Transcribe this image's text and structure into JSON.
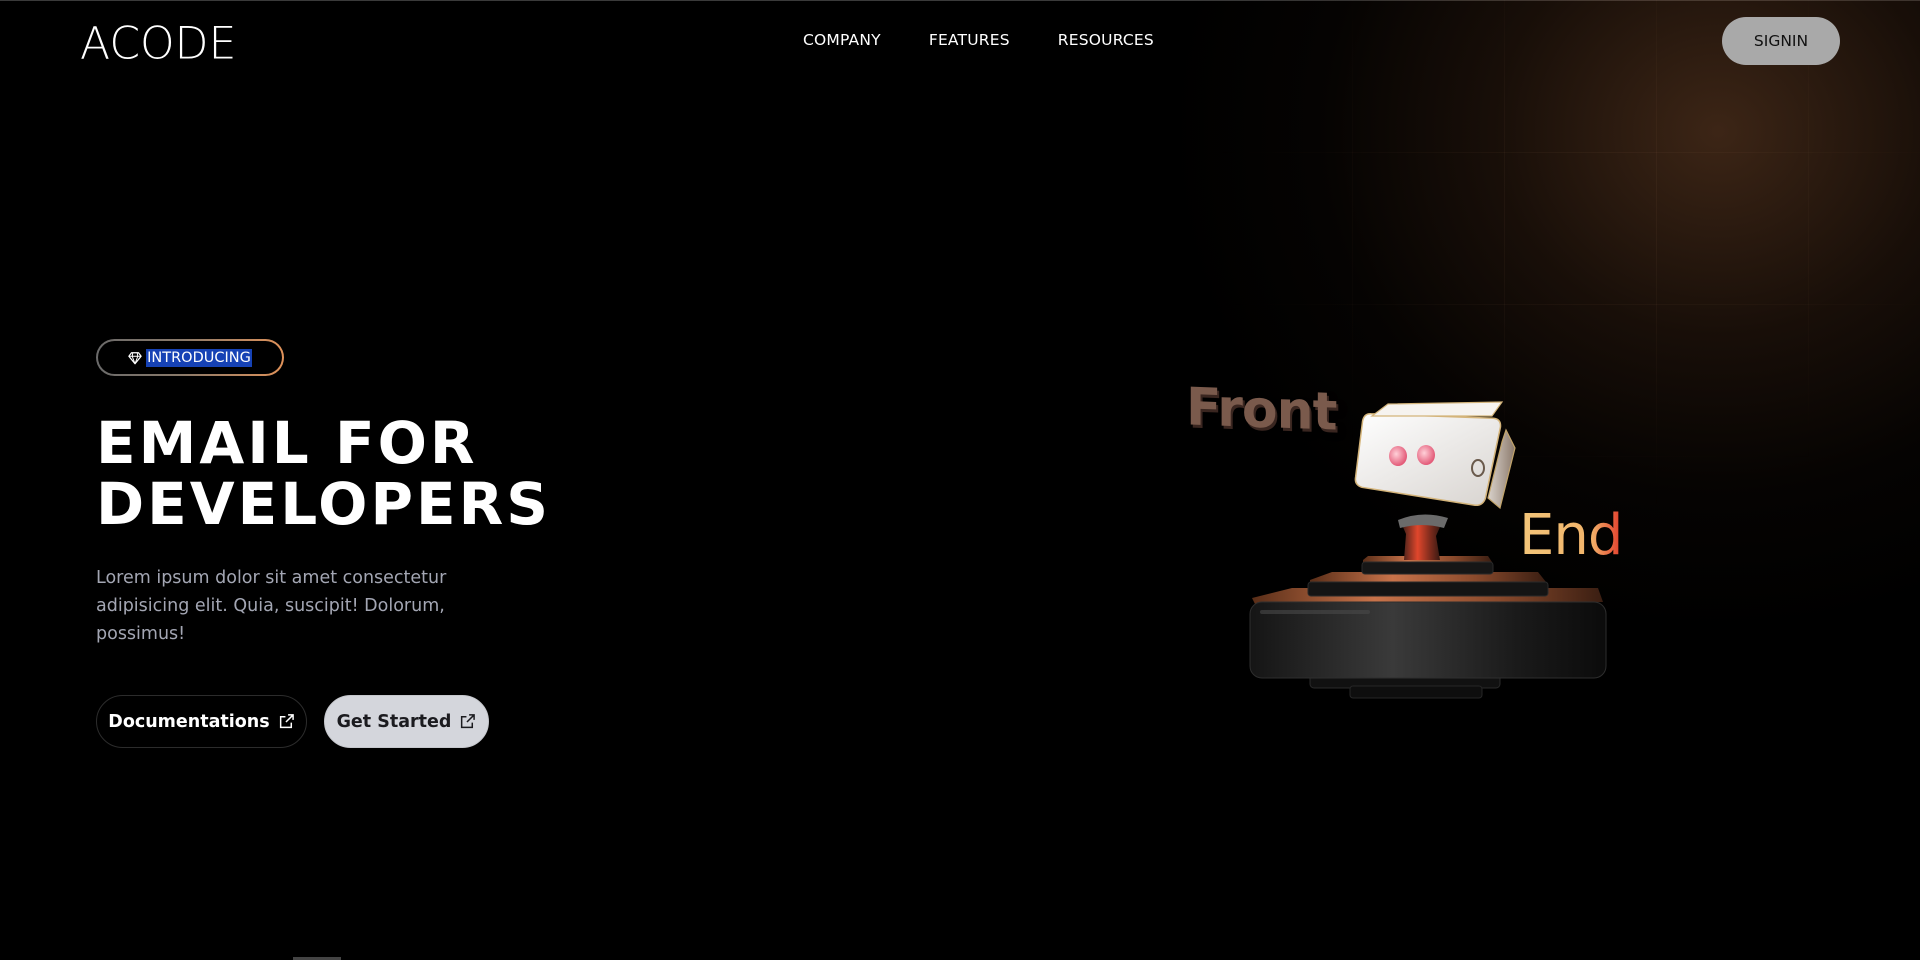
{
  "header": {
    "logo": "ACODE",
    "nav": [
      "COMPANY",
      "FEATURES",
      "RESOURCES"
    ],
    "signin_label": "SIGNIN"
  },
  "hero": {
    "badge_label": "INTRODUCING",
    "badge_icon": "diamond-icon",
    "title_line1": "EMAIL FOR",
    "title_line2": "DEVELOPERS",
    "description": "Lorem ipsum dolor sit amet consectetur adipisicing elit. Quia, suscipit! Dolorum, possimus!",
    "buttons": {
      "docs_label": "Documentations",
      "start_label": "Get Started",
      "icon": "external-link-icon"
    }
  },
  "illustration": {
    "front_label": "Front",
    "end_label": "End"
  },
  "colors": {
    "background": "#000000",
    "signin_bg": "#a9a9a9",
    "primary_button_bg": "#d4d6dc",
    "description_text": "#a3a6b3",
    "badge_gradient_end": "#e0925a",
    "selection_highlight": "#1642b5",
    "end_label_gradient": [
      "#f3c67a",
      "#e23a2a"
    ],
    "front_label": "#7a5a4c"
  }
}
